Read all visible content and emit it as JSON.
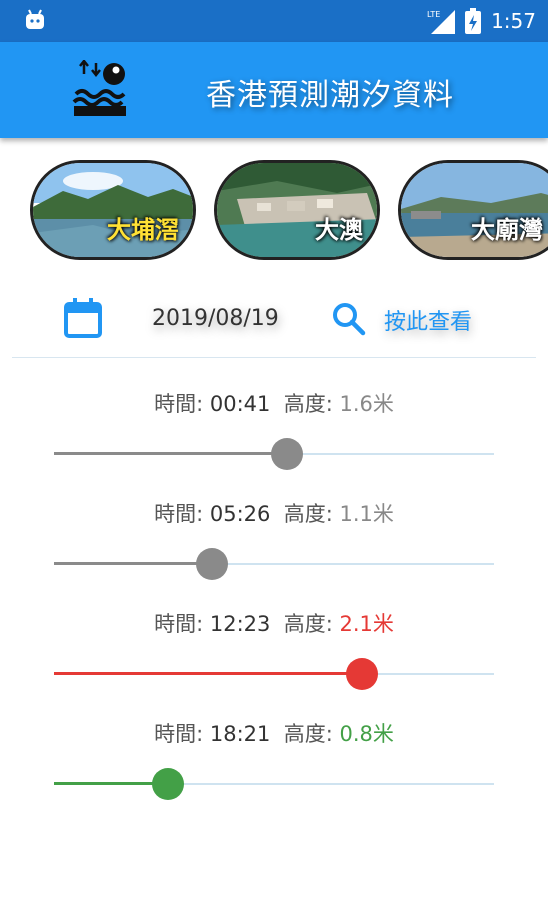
{
  "status": {
    "network": "LTE",
    "time": "1:57"
  },
  "app": {
    "title": "香港預測潮汐資料"
  },
  "places": [
    {
      "name": "大埔滘"
    },
    {
      "name": "大澳"
    },
    {
      "name": "大廟灣"
    }
  ],
  "date": {
    "value": "2019/08/19",
    "search_label": "按此查看"
  },
  "tides": [
    {
      "time_label": "時間:",
      "time": "00:41",
      "height_label": "高度:",
      "height": "1.6",
      "unit": "米",
      "level": 0.53,
      "color": "#8a8a8a",
      "text_color": "#888888"
    },
    {
      "time_label": "時間:",
      "time": "05:26",
      "height_label": "高度:",
      "height": "1.1",
      "unit": "米",
      "level": 0.36,
      "color": "#8a8a8a",
      "text_color": "#888888"
    },
    {
      "time_label": "時間:",
      "time": "12:23",
      "height_label": "高度:",
      "height": "2.1",
      "unit": "米",
      "level": 0.7,
      "color": "#e53935",
      "text_color": "#e53935"
    },
    {
      "time_label": "時間:",
      "time": "18:21",
      "height_label": "高度:",
      "height": "0.8",
      "unit": "米",
      "level": 0.26,
      "color": "#43a047",
      "text_color": "#43a047"
    }
  ]
}
